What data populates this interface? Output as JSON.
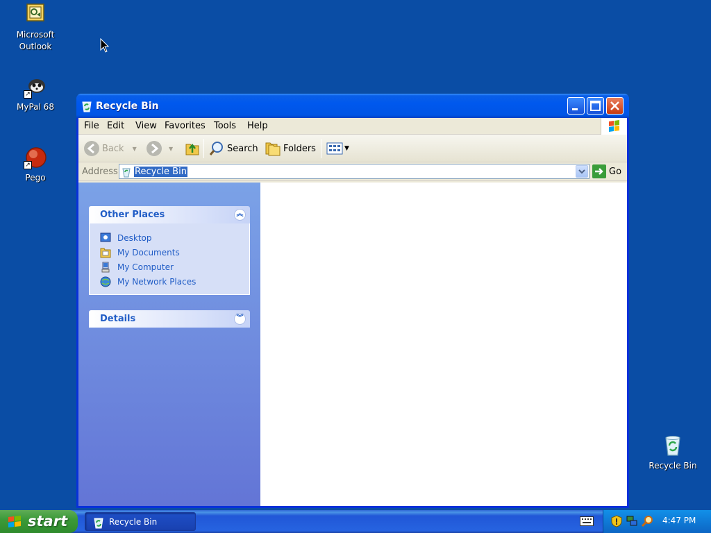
{
  "desktop": {
    "icons": [
      {
        "label_line1": "Microsoft",
        "label_line2": "Outlook"
      },
      {
        "label_line1": "MyPal 68"
      },
      {
        "label_line1": "Pego"
      },
      {
        "label_line1": "Recycle Bin"
      }
    ]
  },
  "window": {
    "title": "Recycle Bin",
    "menu": [
      "File",
      "Edit",
      "View",
      "Favorites",
      "Tools",
      "Help"
    ],
    "toolbar": {
      "back": "Back",
      "search": "Search",
      "folders": "Folders"
    },
    "address": {
      "label": "Address",
      "value": "Recycle Bin",
      "go": "Go"
    },
    "taskpane": {
      "other_places": {
        "title": "Other Places",
        "items": [
          "Desktop",
          "My Documents",
          "My Computer",
          "My Network Places"
        ]
      },
      "details": {
        "title": "Details"
      }
    }
  },
  "taskbar": {
    "start": "start",
    "task_item": "Recycle Bin",
    "clock": "4:47 PM"
  },
  "colors": {
    "desktop": "#0a4da5",
    "titlebar": "#0055e5",
    "taskpane_link": "#215dc6",
    "start_green": "#3c9a39"
  }
}
